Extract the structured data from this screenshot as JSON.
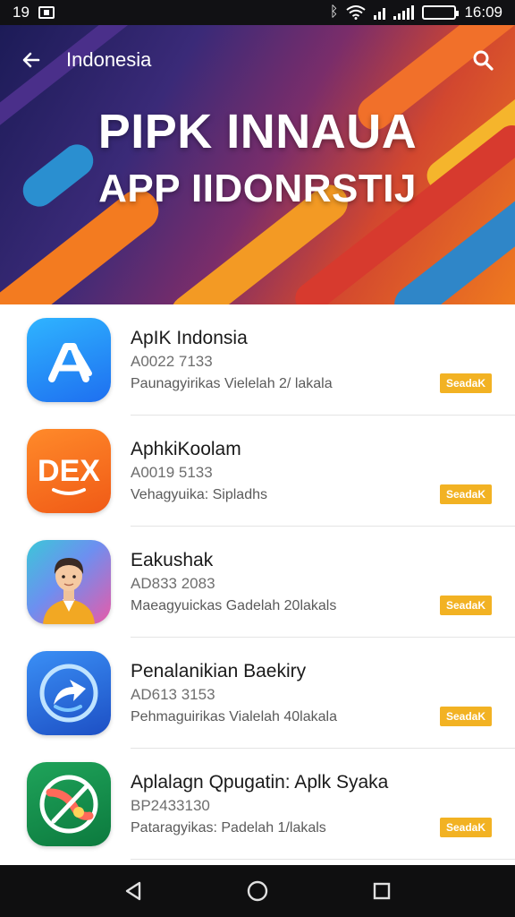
{
  "status_bar": {
    "left_text": "19",
    "time": "16:09"
  },
  "header": {
    "title": "Indonesia",
    "back_icon": "arrow-left-icon",
    "search_icon": "search-icon"
  },
  "hero": {
    "line1": "PIPK INNAUA",
    "line2": "APP IIDONRSTIJ",
    "colors": [
      "#1c1b57",
      "#7a2d6a",
      "#d2472f",
      "#ef7a1f",
      "#2a8fd0"
    ]
  },
  "apps": [
    {
      "name": "ApIK Indonsia",
      "code": "A0022 7133",
      "meta": "Paunagyirikas  Vielelah 2/ lakala",
      "button": "SeadaK",
      "icon": "app-store-a-icon"
    },
    {
      "name": "AphkiKoolam",
      "code": "A0019 5133",
      "meta": "Vehagyuika:  Sipladhs",
      "button": "SeadaK",
      "icon": "dex-logo-icon"
    },
    {
      "name": "Eakushak",
      "code": "AD833 2083",
      "meta": "Maeagyuickas  Gadelah 20lakals",
      "button": "SeadaK",
      "icon": "avatar-person-icon"
    },
    {
      "name": "Penalanikian Baekiry",
      "code": "AD613 3153",
      "meta": "Pehmaguirikas  Vialelah 40lakala",
      "button": "SeadaK",
      "icon": "circular-arrow-icon"
    },
    {
      "name": "Aplalagn Qpugatin: Aplk Syaka",
      "code": "BP2433130",
      "meta": "Pataragyikas:  Padelah 1/lakals",
      "button": "SeadaK",
      "icon": "swirl-logo-icon"
    }
  ],
  "nav": {
    "back": "nav-back-icon",
    "home": "nav-home-icon",
    "recents": "nav-recents-icon"
  },
  "colors": {
    "install_button": "#f2b223",
    "status_bar": "#111114",
    "nav_bar": "#0f0f10"
  }
}
